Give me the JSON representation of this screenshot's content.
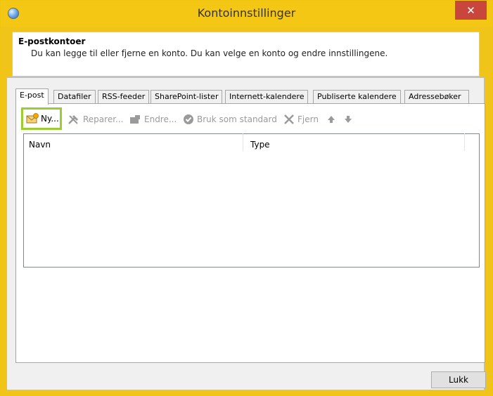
{
  "window": {
    "title": "Kontoinnstillinger",
    "close_glyph": "✕"
  },
  "header": {
    "title": "E-postkontoer",
    "description": "Du kan legge til eller fjerne en konto. Du kan velge en konto og endre innstillingene."
  },
  "tabs": [
    {
      "label": "E-post",
      "active": true
    },
    {
      "label": "Datafiler"
    },
    {
      "label": "RSS-feeder"
    },
    {
      "label": "SharePoint-lister"
    },
    {
      "label": "Internett-kalendere"
    },
    {
      "label": "Publiserte kalendere"
    },
    {
      "label": "Adressebøker"
    }
  ],
  "toolbar": {
    "new": {
      "label": "Ny...",
      "icon": "new-account-icon",
      "enabled": true,
      "highlight": "#9acd32"
    },
    "repair": {
      "label": "Reparer...",
      "icon": "repair-tools-icon",
      "enabled": false
    },
    "change": {
      "label": "Endre...",
      "icon": "change-icon",
      "enabled": false
    },
    "set_default": {
      "label": "Bruk som standard",
      "icon": "checkmark-circle-icon",
      "enabled": false
    },
    "remove": {
      "label": "Fjern",
      "icon": "remove-x-icon",
      "enabled": false
    },
    "move_up_icon": "arrow-up-icon",
    "move_down_icon": "arrow-down-icon"
  },
  "list": {
    "columns": [
      "Navn",
      "Type"
    ],
    "rows": []
  },
  "footer": {
    "close_label": "Lukk"
  },
  "colors": {
    "title_bar": "#f4c715",
    "close_button": "#c9463d",
    "highlight": "#9acd32"
  }
}
